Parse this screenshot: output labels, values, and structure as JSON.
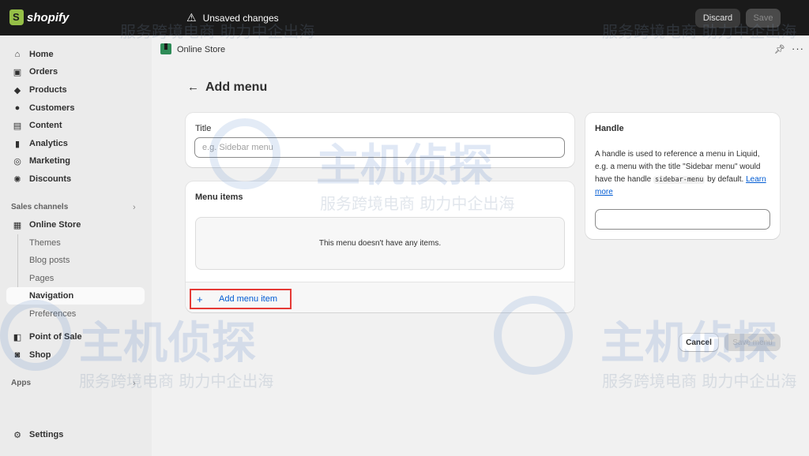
{
  "topbar": {
    "brand": "shopify",
    "status": "Unsaved changes",
    "discard_label": "Discard",
    "save_label": "Save"
  },
  "sidebar": {
    "items": [
      {
        "label": "Home",
        "icon": "home-icon"
      },
      {
        "label": "Orders",
        "icon": "inbox-icon"
      },
      {
        "label": "Products",
        "icon": "tag-icon"
      },
      {
        "label": "Customers",
        "icon": "person-icon"
      },
      {
        "label": "Content",
        "icon": "content-icon"
      },
      {
        "label": "Analytics",
        "icon": "bar-chart-icon"
      },
      {
        "label": "Marketing",
        "icon": "target-icon"
      },
      {
        "label": "Discounts",
        "icon": "discount-icon"
      }
    ],
    "sales_channels_label": "Sales channels",
    "online_store": "Online Store",
    "online_store_sub": [
      "Themes",
      "Blog posts",
      "Pages",
      "Navigation",
      "Preferences"
    ],
    "point_of_sale": "Point of Sale",
    "shop": "Shop",
    "apps_label": "Apps",
    "settings": "Settings"
  },
  "header": {
    "app_title": "Online Store"
  },
  "page": {
    "title": "Add menu",
    "title_card": {
      "label": "Title",
      "placeholder": "e.g. Sidebar menu"
    },
    "menu_items": {
      "heading": "Menu items",
      "empty_text": "This menu doesn't have any items.",
      "add_label": "Add menu item"
    },
    "handle": {
      "heading": "Handle",
      "desc_1": "A handle is used to reference a menu in Liquid, e.g. a menu with the title \"Sidebar menu\" would have the handle",
      "code": "sidebar-menu",
      "desc_2": "by default.",
      "link": "Learn more",
      "value": ""
    },
    "actions": {
      "cancel": "Cancel",
      "save": "Save menu"
    }
  },
  "watermark": {
    "brand_text": "主机侦探",
    "slogan": "服务跨境电商 助力中企出海"
  }
}
